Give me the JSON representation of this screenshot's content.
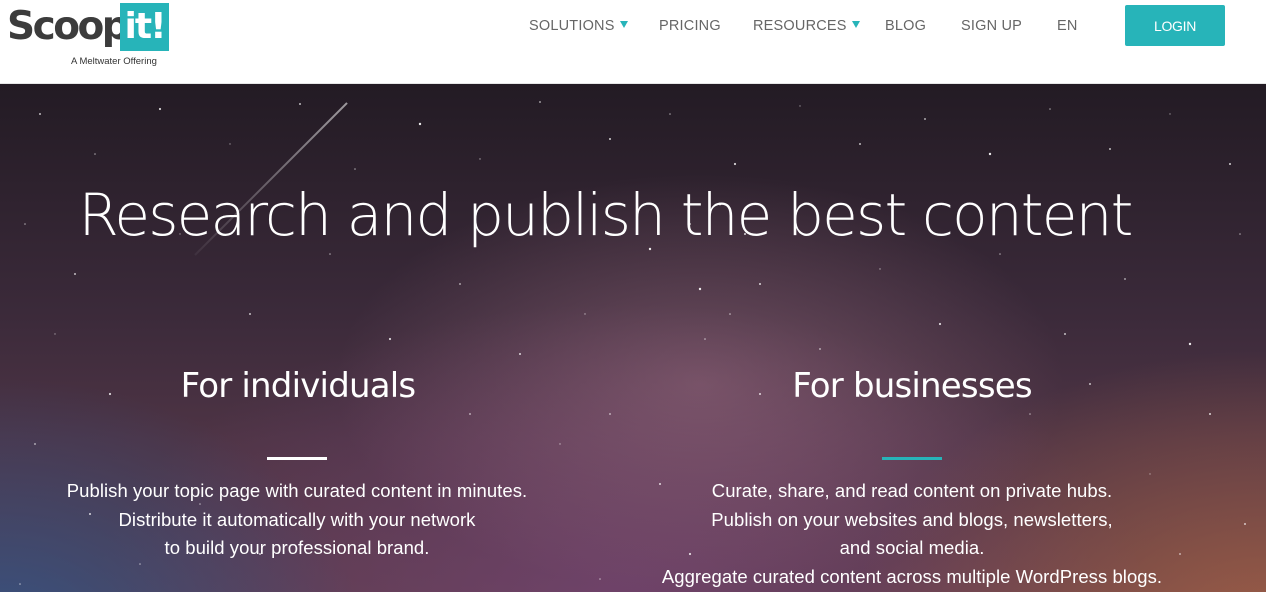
{
  "logo": {
    "word": "Scoop.",
    "box": "it!",
    "tagline": "A Meltwater Offering"
  },
  "nav": {
    "solutions": "SOLUTIONS",
    "pricing": "PRICING",
    "resources": "RESOURCES",
    "blog": "BLOG",
    "signup": "SIGN UP",
    "language": "EN",
    "login": "LOGIN"
  },
  "hero": {
    "title": "Research and publish the best content",
    "individuals": {
      "title": "For individuals",
      "lines": [
        "Publish your topic page with curated content in minutes.",
        "Distribute it automatically with your network",
        "to build your professional brand."
      ]
    },
    "businesses": {
      "title": "For businesses",
      "lines": [
        "Curate, share, and read content on private hubs.",
        "Publish on your websites and blogs, newsletters,",
        "and social media.",
        "Aggregate curated content across multiple WordPress blogs."
      ]
    }
  },
  "colors": {
    "accent": "#27b4b9",
    "individuals_divider": "#ffffff",
    "businesses_divider": "#27b4b9"
  },
  "icons": {
    "dropdown": "caret-down-icon"
  }
}
